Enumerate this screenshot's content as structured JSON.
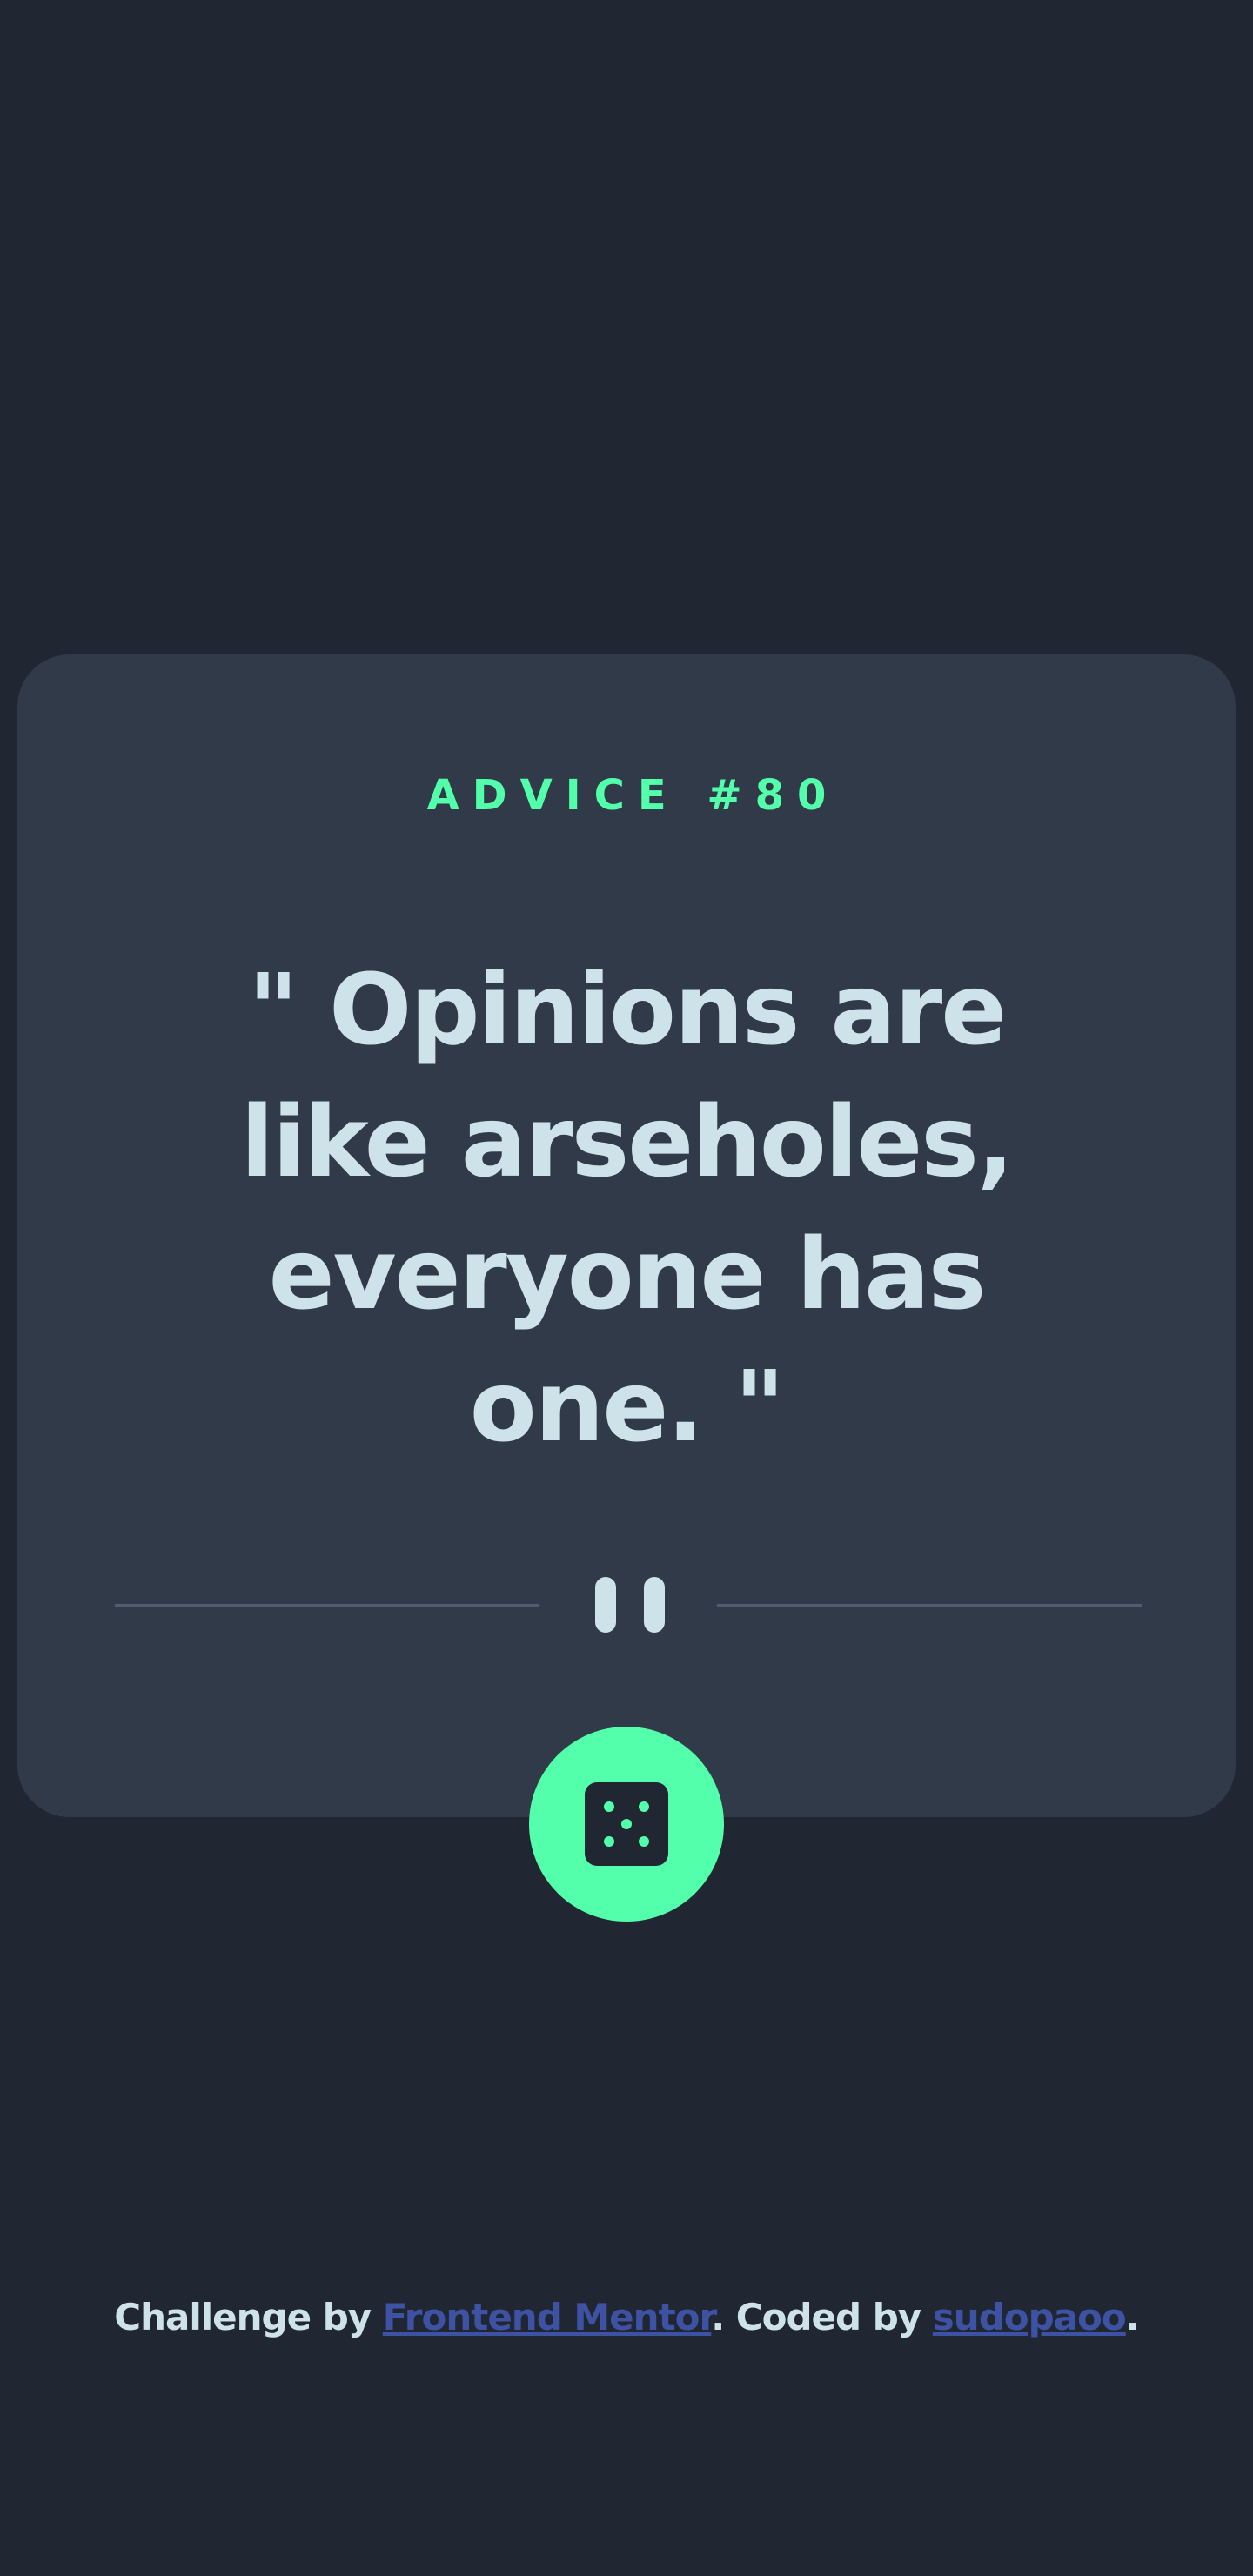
{
  "advice": {
    "id_label": "ADVICE #80",
    "quote": "\" Opinions are like arseholes, everyone has one. \""
  },
  "divider": {
    "icon": "pause-icon"
  },
  "dice_button": {
    "icon": "dice-icon"
  },
  "footer": {
    "prefix": "Challenge by ",
    "link1_text": "Frontend Mentor",
    "middle": ". Coded by ",
    "link2_text": "sudopaoo",
    "suffix": "."
  },
  "colors": {
    "background": "#202632",
    "card": "#313a48",
    "accent": "#53ffaa",
    "text": "#cee3e9",
    "divider": "#4f5d74",
    "link": "#3e52a3"
  }
}
